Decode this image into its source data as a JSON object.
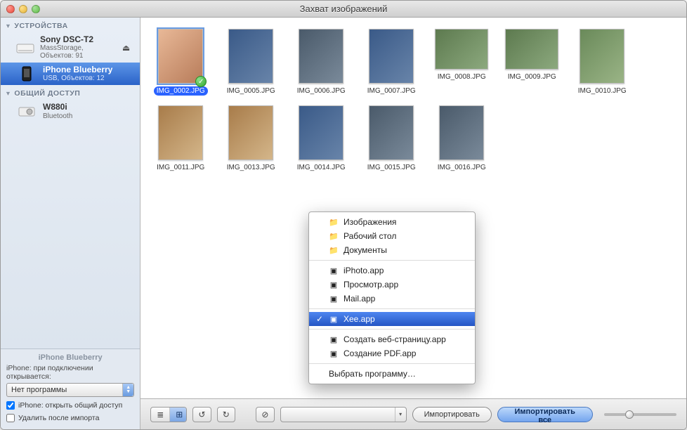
{
  "window": {
    "title": "Захват изображений"
  },
  "sidebar": {
    "devices_header": "УСТРОЙСТВА",
    "shared_header": "ОБЩИЙ ДОСТУП",
    "devices": [
      {
        "name": "Sony DSC-T2",
        "sub": "MassStorage, Объектов: 91"
      },
      {
        "name": "iPhone Blueberry",
        "sub": "USB, Объектов: 12"
      }
    ],
    "shared": [
      {
        "name": "W880i",
        "sub": "Bluetooth"
      }
    ]
  },
  "sidebar_bottom": {
    "title": "iPhone Blueberry",
    "open_label": "iPhone: при подключении открывается:",
    "select_value": "Нет программы",
    "share_label": "iPhone: открыть общий доступ",
    "delete_label": "Удалить после импорта"
  },
  "images": [
    {
      "file": "IMG_0002.JPG",
      "selected": true,
      "check": true,
      "wide": false,
      "tone": "a"
    },
    {
      "file": "IMG_0005.JPG",
      "selected": false,
      "check": false,
      "wide": false,
      "tone": "b"
    },
    {
      "file": "IMG_0006.JPG",
      "selected": false,
      "check": false,
      "wide": false,
      "tone": "d"
    },
    {
      "file": "IMG_0007.JPG",
      "selected": false,
      "check": false,
      "wide": false,
      "tone": "b"
    },
    {
      "file": "IMG_0008.JPG",
      "selected": false,
      "check": false,
      "wide": true,
      "tone": "c"
    },
    {
      "file": "IMG_0009.JPG",
      "selected": false,
      "check": false,
      "wide": true,
      "tone": "c"
    },
    {
      "file": "IMG_0010.JPG",
      "selected": false,
      "check": false,
      "wide": false,
      "tone": "f"
    },
    {
      "file": "IMG_0011.JPG",
      "selected": false,
      "check": false,
      "wide": false,
      "tone": "e"
    },
    {
      "file": "IMG_0013.JPG",
      "selected": false,
      "check": false,
      "wide": false,
      "tone": "e"
    },
    {
      "file": "IMG_0014.JPG",
      "selected": false,
      "check": false,
      "wide": false,
      "tone": "b"
    },
    {
      "file": "IMG_0015.JPG",
      "selected": false,
      "check": false,
      "wide": false,
      "tone": "d"
    },
    {
      "file": "IMG_0016.JPG",
      "selected": false,
      "check": false,
      "wide": false,
      "tone": "d"
    }
  ],
  "toolbar": {
    "import_button": "Импортировать",
    "import_all_button": "Импортировать все"
  },
  "popup": {
    "groups": [
      [
        {
          "label": "Изображения",
          "icon": "folder"
        },
        {
          "label": "Рабочий стол",
          "icon": "folder"
        },
        {
          "label": "Документы",
          "icon": "folder"
        }
      ],
      [
        {
          "label": "iPhoto.app",
          "icon": "app"
        },
        {
          "label": "Просмотр.app",
          "icon": "app"
        },
        {
          "label": "Mail.app",
          "icon": "app"
        }
      ],
      [
        {
          "label": "Xee.app",
          "icon": "app",
          "selected": true
        }
      ],
      [
        {
          "label": "Создать веб-страницу.app",
          "icon": "app"
        },
        {
          "label": "Создание PDF.app",
          "icon": "app"
        }
      ],
      [
        {
          "label": "Выбрать программу…",
          "icon": ""
        }
      ]
    ]
  }
}
